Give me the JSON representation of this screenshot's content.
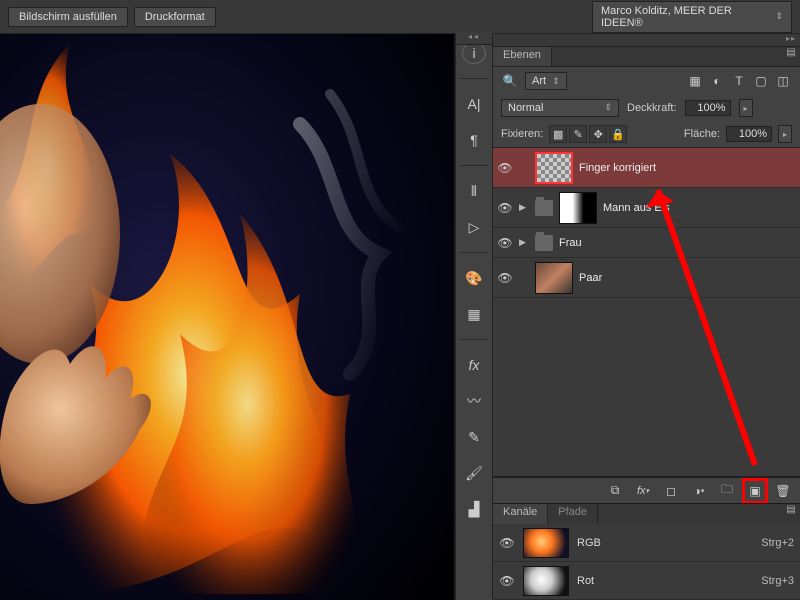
{
  "topbar": {
    "fill_screen": "Bildschirm ausfüllen",
    "print_format": "Druckformat",
    "workspace": "Marco Kolditz, MEER DER IDEEN®"
  },
  "layers_panel": {
    "tab_label": "Ebenen",
    "filter_kind": "Art",
    "blend_mode": "Normal",
    "opacity_label": "Deckkraft:",
    "opacity_value": "100%",
    "lock_label": "Fixieren:",
    "fill_label": "Fläche:",
    "fill_value": "100%",
    "layers": [
      {
        "name": "Finger korrigiert",
        "type": "pixel",
        "selected": true
      },
      {
        "name": "Mann aus Eis",
        "type": "group",
        "mask": true
      },
      {
        "name": "Frau",
        "type": "group"
      },
      {
        "name": "Paar",
        "type": "pixel",
        "photo": true
      }
    ]
  },
  "channels_panel": {
    "tab_channels": "Kanäle",
    "tab_paths": "Pfade",
    "items": [
      {
        "name": "RGB",
        "shortcut": "Strg+2",
        "kind": "rgb"
      },
      {
        "name": "Rot",
        "shortcut": "Strg+3",
        "kind": "mono"
      }
    ]
  },
  "icons": {
    "search": "🔍",
    "info": "ⓘ"
  }
}
